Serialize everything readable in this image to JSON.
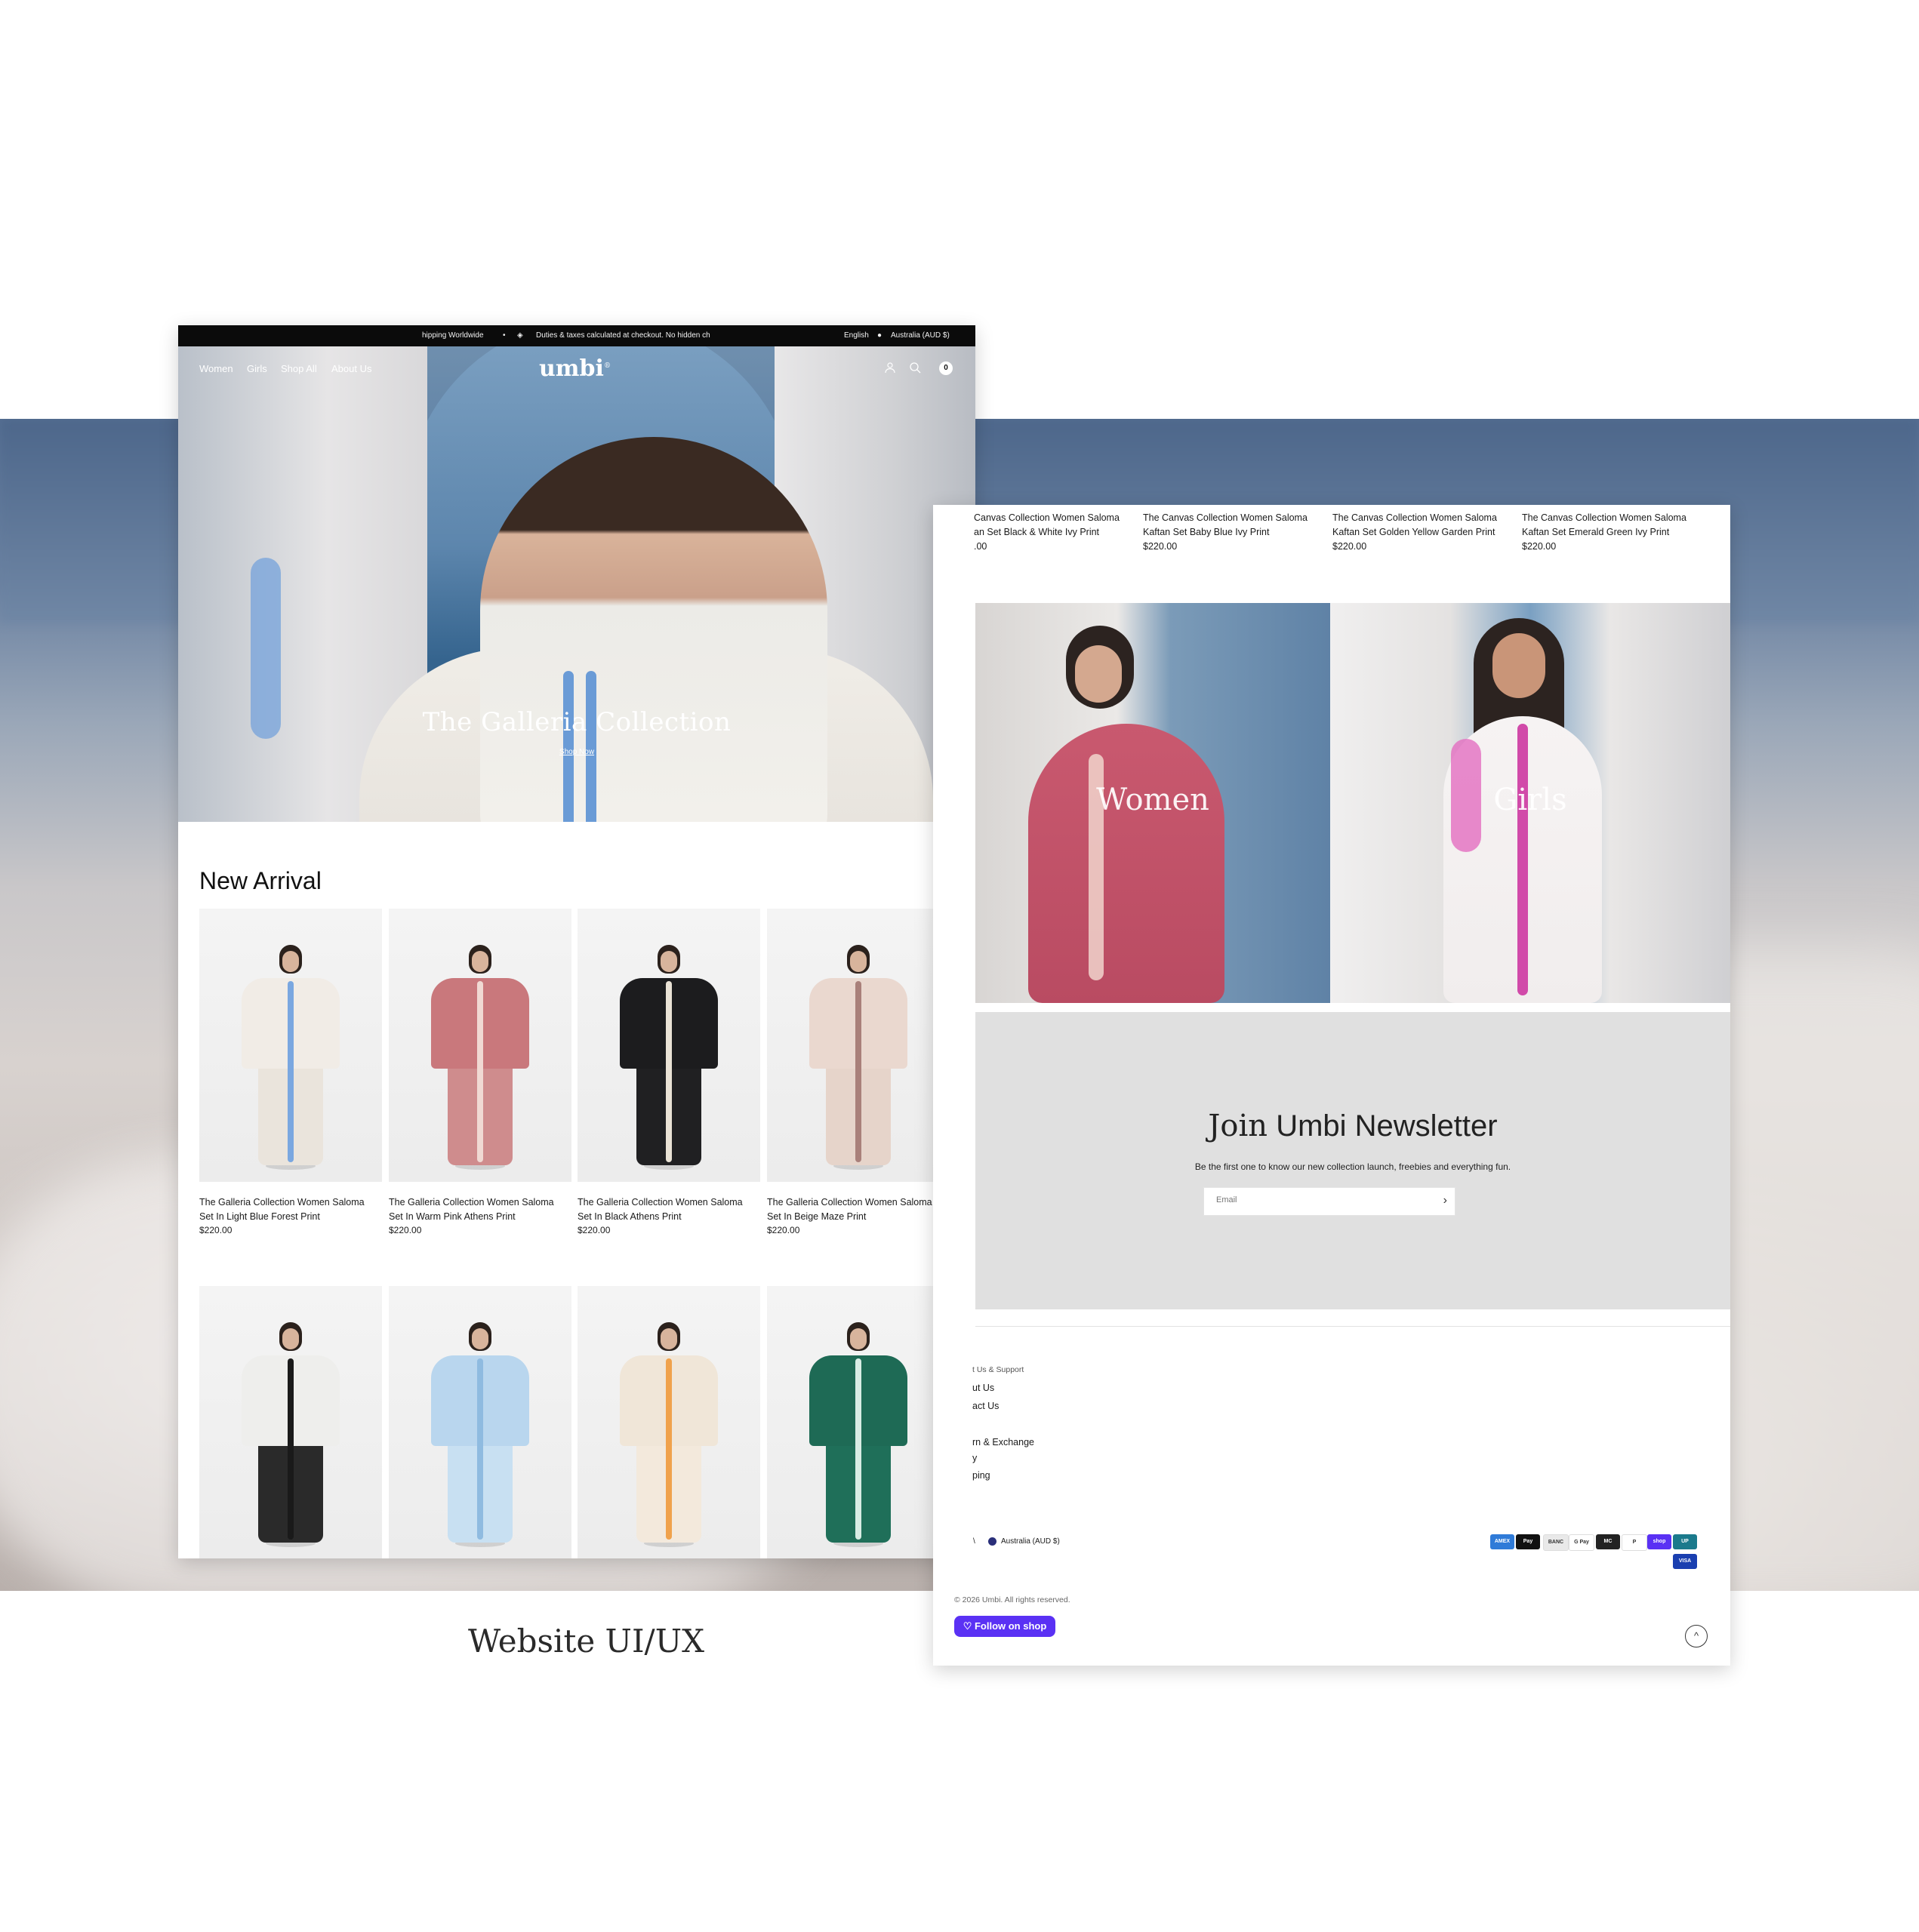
{
  "announcement": {
    "msg1": "hipping Worldwide",
    "msg2": "Duties & taxes calculated at checkout. No hidden ch",
    "language": "English",
    "country": "Australia (AUD $)"
  },
  "nav": {
    "links": [
      "Women",
      "Girls",
      "Shop All",
      "About Us"
    ],
    "logo": "umbi",
    "logo_mark": "®",
    "cart_count": "0"
  },
  "hero": {
    "title": "The Galleria Collection",
    "cta": "Shop Now"
  },
  "new_arrival": {
    "title": "New Arrival",
    "products": [
      {
        "name_line1": "The Galleria Collection Women Saloma",
        "name_line2": "Set In Light Blue Forest Print",
        "price": "$220.00",
        "top": "#f1ece6",
        "skirt": "#eae4dc",
        "motif": "#7aa7e0"
      },
      {
        "name_line1": "The Galleria Collection Women Saloma",
        "name_line2": "Set In Warm Pink Athens Print",
        "price": "$220.00",
        "top": "#c9787c",
        "skirt": "#cf8c8d",
        "motif": "#f0d9d3"
      },
      {
        "name_line1": "The Galleria Collection Women Saloma",
        "name_line2": "Set In Black Athens Print",
        "price": "$220.00",
        "top": "#1c1c1e",
        "skirt": "#202022",
        "motif": "#e9e2d5"
      },
      {
        "name_line1": "The Galleria Collection Women Saloma",
        "name_line2": "Set In Beige Maze Print",
        "price": "$220.00",
        "top": "#ead8cf",
        "skirt": "#e6d4ca",
        "motif": "#a9807a"
      }
    ],
    "products_row2": [
      {
        "top": "#eeeeec",
        "skirt": "#2a2a2a",
        "motif": "#1a1a1a"
      },
      {
        "top": "#b9d6ee",
        "skirt": "#c8e0f2",
        "motif": "#8fbbe0"
      },
      {
        "top": "#f0e6d8",
        "skirt": "#f3e9dc",
        "motif": "#f0a24c"
      },
      {
        "top": "#1e6a55",
        "skirt": "#1f6f59",
        "motif": "#d8ece4"
      }
    ]
  },
  "canvas_products": [
    {
      "name_line1": "Canvas Collection Women Saloma",
      "name_line2": "an Set Black & White Ivy Print",
      "price": ".00"
    },
    {
      "name_line1": "The Canvas Collection Women Saloma",
      "name_line2": "Kaftan Set Baby Blue Ivy Print",
      "price": "$220.00"
    },
    {
      "name_line1": "The Canvas Collection Women Saloma",
      "name_line2": "Kaftan Set Golden Yellow Garden Print",
      "price": "$220.00"
    },
    {
      "name_line1": "The Canvas Collection Women Saloma",
      "name_line2": "Kaftan Set Emerald Green Ivy Print",
      "price": "$220.00"
    }
  ],
  "categories": {
    "women": "Women",
    "girls": "Girls"
  },
  "newsletter": {
    "title_serif": "Join",
    "title_sans": "Umbi Newsletter",
    "subtitle": "Be the first one to know our new collection launch, freebies and everything fun.",
    "placeholder": "Email"
  },
  "footer": {
    "heading": "t Us & Support",
    "links": [
      "ut Us",
      "act Us",
      "",
      "rn & Exchange",
      "y",
      "ping"
    ],
    "country_prefix": "\\",
    "country": "Australia (AUD $)",
    "payments": [
      {
        "label": "AMEX",
        "color": "#2f7bd8"
      },
      {
        "label": "Pay",
        "color": "#111111"
      },
      {
        "label": "BANC",
        "color": "#e9e9e9"
      },
      {
        "label": "G Pay",
        "color": "#ffffff"
      },
      {
        "label": "MC",
        "color": "#222222"
      },
      {
        "label": "P",
        "color": "#ffffff"
      },
      {
        "label": "shop",
        "color": "#5a31f4"
      },
      {
        "label": "UP",
        "color": "#1b7a8c"
      },
      {
        "label": "VISA",
        "color": "#1a3fb0"
      }
    ],
    "copyright": "© 2026 Umbi. All rights reserved.",
    "follow_label": "Follow on shop"
  },
  "caption": "Website UI/UX"
}
